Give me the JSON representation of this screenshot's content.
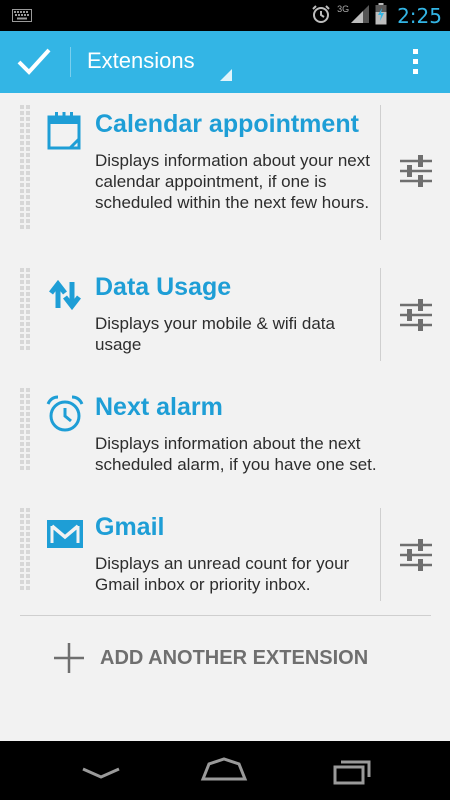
{
  "status_bar": {
    "time": "2:25",
    "network_label": "3G",
    "icons": [
      "keyboard-icon",
      "alarm-icon",
      "signal-icon",
      "battery-charging-icon"
    ]
  },
  "action_bar": {
    "done_icon": "check-icon",
    "title": "Extensions",
    "overflow_icon": "overflow-menu-icon",
    "accent": "#33b5e5"
  },
  "extensions": [
    {
      "title": "Calendar appointment",
      "description": "Displays information about your next calendar appointment, if one is scheduled within the next few hours.",
      "icon": "calendar-icon",
      "has_settings": true
    },
    {
      "title": "Data Usage",
      "description": "Displays your mobile & wifi data usage",
      "icon": "data-transfer-icon",
      "has_settings": true
    },
    {
      "title": "Next alarm",
      "description": "Displays information about the next scheduled alarm, if you have one set.",
      "icon": "alarm-clock-icon",
      "has_settings": false
    },
    {
      "title": "Gmail",
      "description": "Displays an unread count for your Gmail inbox or priority inbox.",
      "icon": "gmail-icon",
      "has_settings": true
    }
  ],
  "add_extension": {
    "label": "ADD ANOTHER EXTENSION",
    "icon": "plus-icon"
  },
  "nav_bar": {
    "buttons": [
      "back-icon",
      "home-icon",
      "recent-apps-icon"
    ]
  }
}
